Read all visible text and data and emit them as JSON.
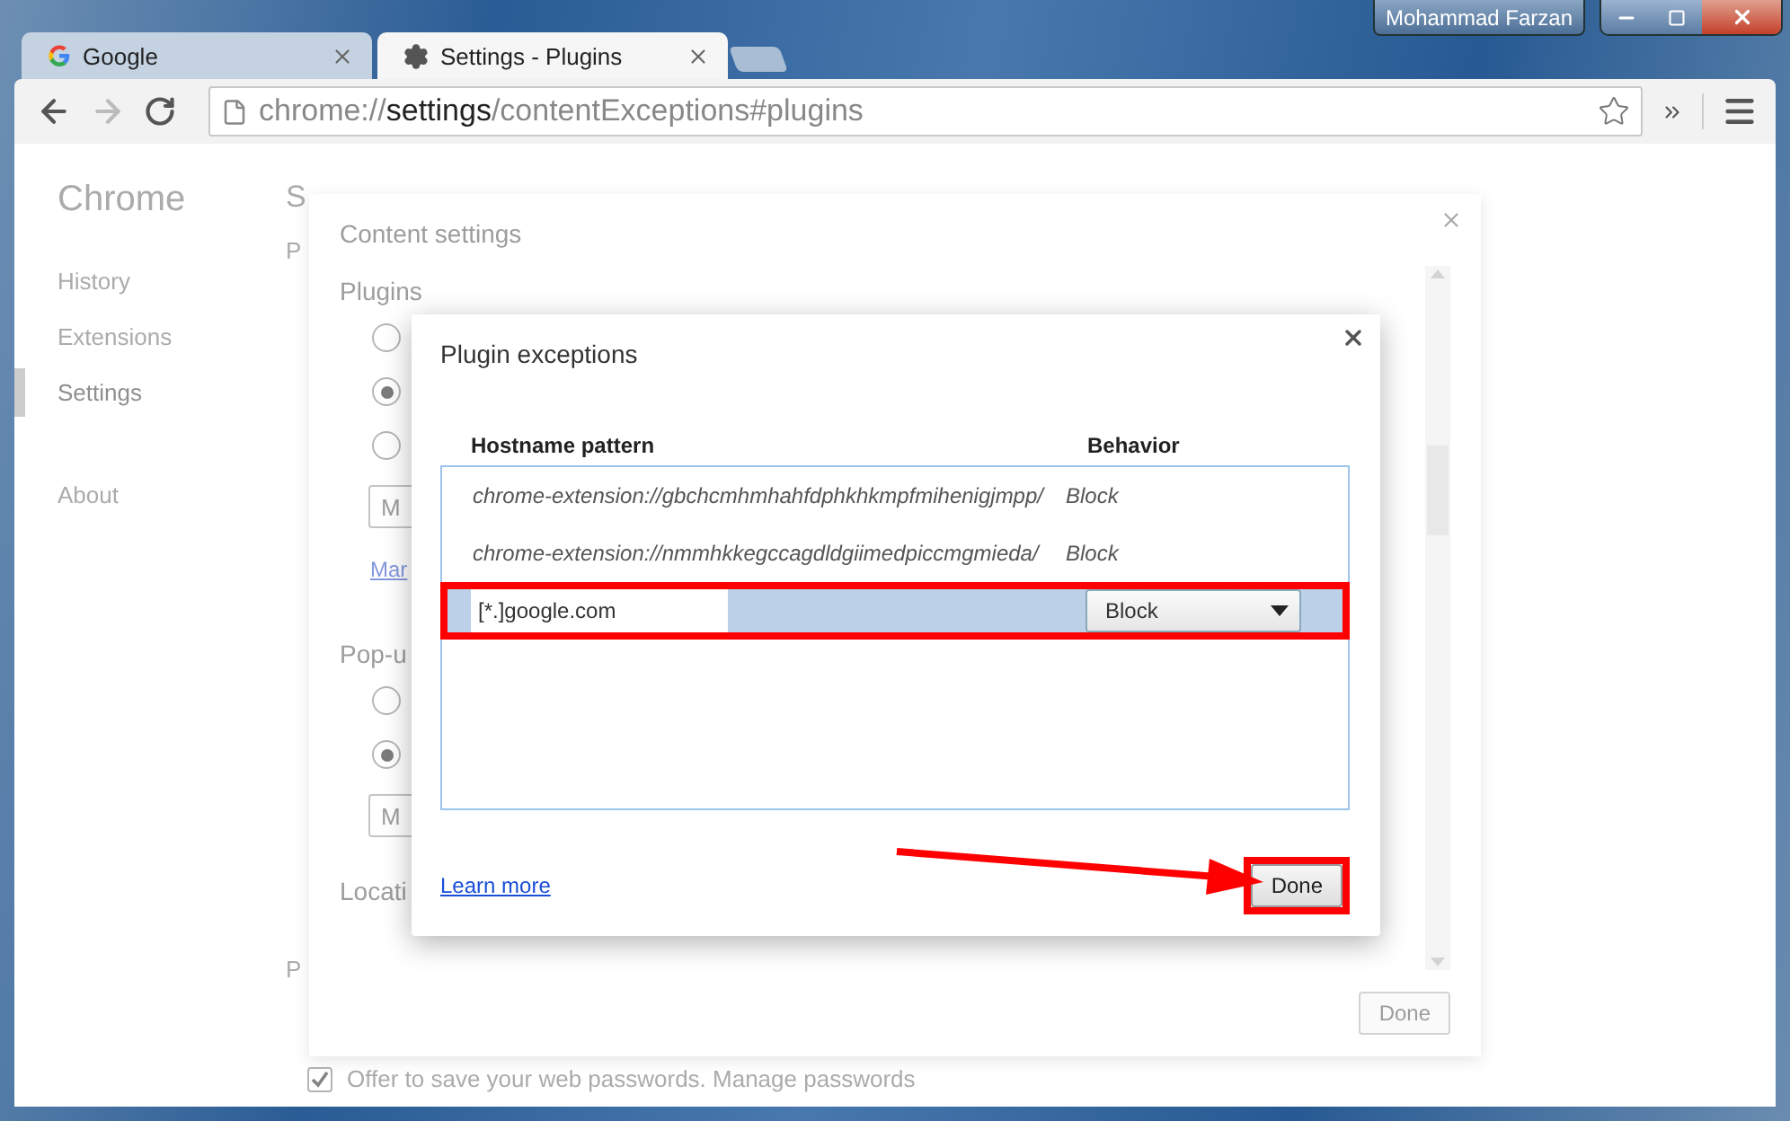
{
  "window": {
    "user": "Mohammad Farzan"
  },
  "tabs": [
    {
      "title": "Google",
      "selected": false
    },
    {
      "title": "Settings - Plugins",
      "selected": true
    }
  ],
  "address_bar": {
    "scheme": "chrome://",
    "host": "settings",
    "path": "/contentExceptions#plugins"
  },
  "settings_page": {
    "brand": "Chrome",
    "nav": [
      {
        "label": "History",
        "selected": false
      },
      {
        "label": "Extensions",
        "selected": false
      },
      {
        "label": "Settings",
        "selected": true
      },
      {
        "label": "About",
        "selected": false
      }
    ],
    "heading": "S",
    "section_fragments": [
      "P",
      "P"
    ],
    "password_option": {
      "label": "Offer to save your web passwords. Manage passwords",
      "checked": true
    }
  },
  "content_settings": {
    "title": "Content settings",
    "sections": [
      {
        "heading": "Plugins",
        "radios": [
          {
            "selected": false
          },
          {
            "selected": true
          },
          {
            "selected": false
          }
        ],
        "button": "M",
        "link": "Mar"
      },
      {
        "heading": "Pop-u",
        "radios": [
          {
            "selected": false
          },
          {
            "selected": true
          }
        ],
        "button": "M"
      },
      {
        "heading": "Locati"
      }
    ],
    "done": {
      "label": "Done",
      "disabled": true
    }
  },
  "plugin_exceptions": {
    "title": "Plugin exceptions",
    "columns": [
      "Hostname pattern",
      "Behavior"
    ],
    "rows": [
      {
        "kind": "entry",
        "pattern": "chrome-extension://gbchcmhmhahfdphkhkmpfmihenigjmpp/",
        "behavior": "Block",
        "highlighted": false
      },
      {
        "kind": "entry",
        "pattern": "chrome-extension://nmmhkkegccagdldgiimedpiccmgmieda/",
        "behavior": "Block",
        "highlighted": false
      },
      {
        "kind": "editing",
        "pattern": "[*.]google.com",
        "behavior": "Block",
        "highlighted": true
      }
    ],
    "link": "Learn more",
    "done": {
      "label": "Done",
      "highlighted": true
    }
  }
}
